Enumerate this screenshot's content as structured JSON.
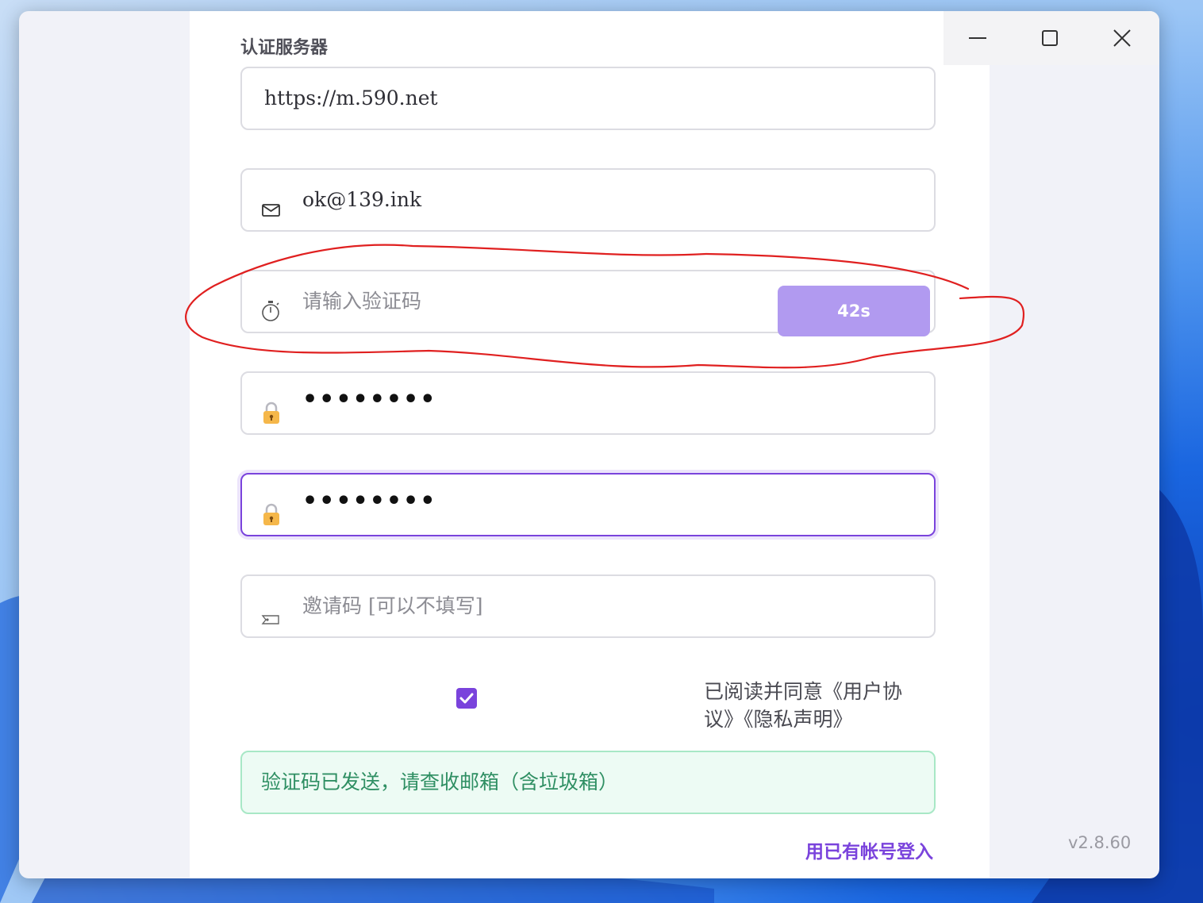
{
  "colors": {
    "accent": "#7a43dc",
    "accent_light": "#b19af0",
    "success_text": "#2f8f63",
    "success_bg": "#edfbf4",
    "annotation": "#e02020"
  },
  "window": {
    "controls": {
      "minimize_icon": "minimize-icon",
      "maximize_icon": "maximize-icon",
      "close_icon": "close-icon"
    }
  },
  "form": {
    "server_label": "认证服务器",
    "server_value": "https://m.590.net",
    "email_icon": "mail-icon",
    "email_value": "ok@139.ink",
    "code_icon": "stopwatch-icon",
    "code_placeholder": "请输入验证码",
    "code_button_label": "42s",
    "password_icon": "lock-icon",
    "password_value": "••••••••",
    "confirm_password_value": "••••••••",
    "invite_icon": "tag-icon",
    "invite_placeholder": "邀请码 [可以不填写]",
    "agreement_checked": true,
    "agreement_text": "已阅读并同意《用户协议》《隐私声明》",
    "notice_text": "验证码已发送，请查收邮箱（含垃圾箱）",
    "login_link": "用已有帐号登入",
    "version": "v2.8.60"
  }
}
